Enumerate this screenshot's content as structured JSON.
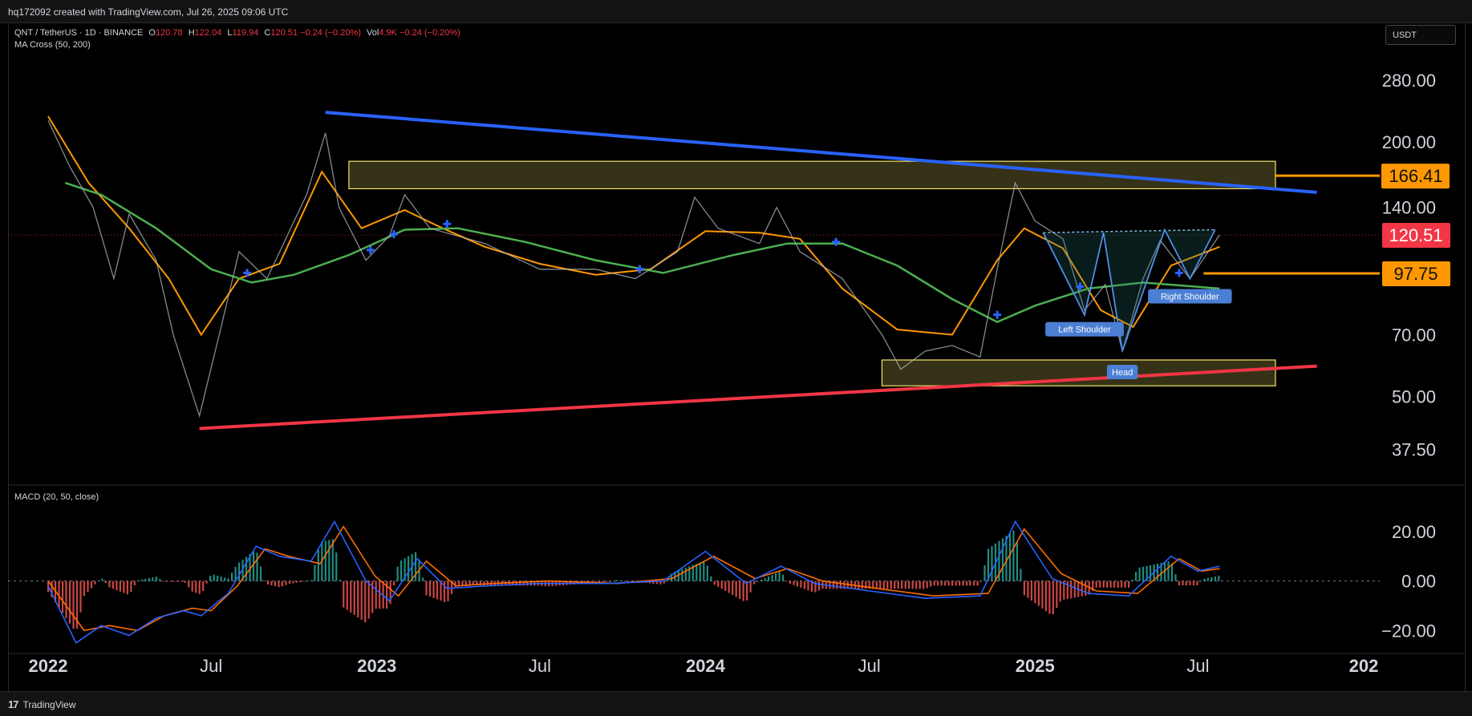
{
  "header": {
    "credit": "hq172092 created with TradingView.com, Jul 26, 2025 09:06 UTC"
  },
  "legend": {
    "symbol": "QNT / TetherUS · 1D · BINANCE",
    "open_label": "O",
    "open": "120.78",
    "high_label": "H",
    "high": "122.04",
    "low_label": "L",
    "low": "119.94",
    "close_label": "C",
    "close": "120.51",
    "change": "−0.24 (−0.20%)",
    "vol_label": "Vol",
    "vol": "4.9K",
    "vol_change": "−0.24 (−0.20%)",
    "indicator": "MA Cross (50, 200)"
  },
  "currency_button": "USDT",
  "macd_legend": "MACD (20, 50, close)",
  "footer": {
    "brand": "TradingView"
  },
  "colors": {
    "background": "#000000",
    "trend_blue": "#2962ff",
    "trend_red": "#f23645",
    "ma_fast": "#ff9800",
    "ma_slow": "#4caf50",
    "zone": "#f5e56b",
    "price_badge": "#f23645",
    "level_badge": "#ff9800",
    "macd_line": "#2962ff",
    "signal_line": "#ff6d00",
    "hist_up": "#26a69a",
    "hist_down": "#ef5350"
  },
  "price_badges": [
    {
      "label": "166.41",
      "color": "#ff9800"
    },
    {
      "label": "120.51",
      "color": "#f23645"
    },
    {
      "label": "97.75",
      "color": "#ff9800"
    }
  ],
  "pattern_labels": [
    "Left Shoulder",
    "Head",
    "Right Shoulder"
  ],
  "chart_data": [
    {
      "type": "line",
      "title": "QNT / TetherUS · 1D · BINANCE",
      "log_scale": true,
      "y_ticks": [
        "280.00",
        "200.00",
        "140.00",
        "70.00",
        "50.00",
        "37.50"
      ],
      "x_ticks": [
        "2022",
        "Jul",
        "2023",
        "Jul",
        "2024",
        "Jul",
        "2025",
        "Jul",
        "202"
      ],
      "ylim": [
        31,
        380
      ],
      "series": [
        {
          "name": "MA 50",
          "values": [
            [
              "2022-01-01",
              230
            ],
            [
              "2022-02-15",
              160
            ],
            [
              "2022-04-01",
              125
            ],
            [
              "2022-05-15",
              95
            ],
            [
              "2022-06-20",
              70
            ],
            [
              "2022-08-01",
              95
            ],
            [
              "2022-09-15",
              103
            ],
            [
              "2022-11-01",
              170
            ],
            [
              "2022-12-15",
              125
            ],
            [
              "2023-02-01",
              138
            ],
            [
              "2023-03-15",
              125
            ],
            [
              "2023-05-01",
              113
            ],
            [
              "2023-07-01",
              103
            ],
            [
              "2023-09-01",
              97
            ],
            [
              "2023-11-01",
              100
            ],
            [
              "2024-01-01",
              123
            ],
            [
              "2024-03-01",
              122
            ],
            [
              "2024-04-15",
              118
            ],
            [
              "2024-06-01",
              90
            ],
            [
              "2024-08-01",
              72
            ],
            [
              "2024-10-01",
              70
            ],
            [
              "2024-11-20",
              105
            ],
            [
              "2024-12-20",
              125
            ],
            [
              "2025-02-01",
              112
            ],
            [
              "2025-03-15",
              80
            ],
            [
              "2025-04-20",
              73
            ],
            [
              "2025-06-01",
              102
            ],
            [
              "2025-07-25",
              113
            ]
          ]
        },
        {
          "name": "MA 200",
          "values": [
            [
              "2022-01-20",
              160
            ],
            [
              "2022-03-01",
              150
            ],
            [
              "2022-05-01",
              125
            ],
            [
              "2022-07-01",
              100
            ],
            [
              "2022-08-15",
              93
            ],
            [
              "2022-10-01",
              97
            ],
            [
              "2022-12-01",
              108
            ],
            [
              "2023-02-01",
              124
            ],
            [
              "2023-04-01",
              125
            ],
            [
              "2023-06-15",
              116
            ],
            [
              "2023-09-01",
              105
            ],
            [
              "2023-11-15",
              98
            ],
            [
              "2024-02-01",
              108
            ],
            [
              "2024-04-01",
              115
            ],
            [
              "2024-06-01",
              115
            ],
            [
              "2024-08-01",
              102
            ],
            [
              "2024-10-01",
              85
            ],
            [
              "2024-11-20",
              75
            ],
            [
              "2025-01-01",
              82
            ],
            [
              "2025-03-01",
              90
            ],
            [
              "2025-05-01",
              93
            ],
            [
              "2025-07-25",
              90
            ]
          ]
        },
        {
          "name": "QNTUSDT close",
          "values": [
            [
              "2022-01-01",
              225
            ],
            [
              "2022-01-25",
              175
            ],
            [
              "2022-02-20",
              140
            ],
            [
              "2022-03-15",
              95
            ],
            [
              "2022-04-01",
              135
            ],
            [
              "2022-05-01",
              105
            ],
            [
              "2022-05-20",
              70
            ],
            [
              "2022-06-18",
              45
            ],
            [
              "2022-07-10",
              70
            ],
            [
              "2022-08-01",
              110
            ],
            [
              "2022-09-01",
              95
            ],
            [
              "2022-10-15",
              150
            ],
            [
              "2022-11-05",
              210
            ],
            [
              "2022-11-20",
              140
            ],
            [
              "2022-12-20",
              105
            ],
            [
              "2023-01-15",
              120
            ],
            [
              "2023-02-01",
              150
            ],
            [
              "2023-03-01",
              125
            ],
            [
              "2023-05-01",
              115
            ],
            [
              "2023-07-01",
              100
            ],
            [
              "2023-09-01",
              100
            ],
            [
              "2023-10-15",
              95
            ],
            [
              "2023-12-01",
              110
            ],
            [
              "2023-12-20",
              148
            ],
            [
              "2024-01-15",
              125
            ],
            [
              "2024-03-01",
              115
            ],
            [
              "2024-03-20",
              140
            ],
            [
              "2024-04-15",
              110
            ],
            [
              "2024-06-01",
              95
            ],
            [
              "2024-07-15",
              70
            ],
            [
              "2024-08-05",
              58
            ],
            [
              "2024-09-01",
              64
            ],
            [
              "2024-10-01",
              66
            ],
            [
              "2024-11-01",
              62
            ],
            [
              "2024-11-20",
              100
            ],
            [
              "2024-12-10",
              160
            ],
            [
              "2025-01-01",
              130
            ],
            [
              "2025-02-01",
              118
            ],
            [
              "2025-02-25",
              80
            ],
            [
              "2025-03-20",
              92
            ],
            [
              "2025-04-08",
              64
            ],
            [
              "2025-05-01",
              95
            ],
            [
              "2025-05-20",
              117
            ],
            [
              "2025-06-22",
              95
            ],
            [
              "2025-07-25",
              120.51
            ]
          ]
        }
      ],
      "lines": [
        {
          "name": "descending resistance",
          "start": [
            "2022-11-05",
            235
          ],
          "end": [
            "2025-11-10",
            152
          ]
        },
        {
          "name": "ascending support",
          "start": [
            "2022-06-18",
            42
          ],
          "end": [
            "2025-11-10",
            59
          ]
        }
      ],
      "zones": [
        {
          "name": "resistance zone",
          "from": "2022-12-01",
          "to": "2025-09-25",
          "low": 155,
          "high": 180
        },
        {
          "name": "support zone",
          "from": "2024-07-15",
          "to": "2025-09-25",
          "low": 53,
          "high": 61
        }
      ],
      "cross_markers": [
        [
          "2022-08-10",
          98
        ],
        [
          "2022-12-25",
          111
        ],
        [
          "2023-01-20",
          121
        ],
        [
          "2023-03-20",
          128
        ],
        [
          "2023-10-20",
          100
        ],
        [
          "2024-05-25",
          116
        ],
        [
          "2024-11-20",
          78
        ],
        [
          "2025-02-20",
          91
        ],
        [
          "2025-06-10",
          98
        ]
      ],
      "levels": [
        {
          "value": 166.41
        },
        {
          "value": 120.51
        },
        {
          "value": 97.75
        }
      ],
      "head_and_shoulders": {
        "left_shoulder": [
          "2025-02-25",
          78
        ],
        "head": [
          "2025-04-08",
          64
        ],
        "right_shoulder": [
          "2025-06-22",
          95
        ],
        "neckline": [
          [
            "2025-01-10",
            122
          ],
          [
            "2025-07-20",
            124
          ]
        ]
      }
    },
    {
      "type": "line",
      "title": "MACD (20, 50, close)",
      "y_ticks": [
        "20.00",
        "0.00",
        "−20.00"
      ],
      "ylim": [
        -27,
        30
      ],
      "series": [
        {
          "name": "MACD",
          "values": [
            [
              "2022-01-01",
              -2
            ],
            [
              "2022-02-01",
              -25
            ],
            [
              "2022-03-01",
              -18
            ],
            [
              "2022-04-01",
              -22
            ],
            [
              "2022-05-01",
              -15
            ],
            [
              "2022-06-01",
              -12
            ],
            [
              "2022-06-20",
              -14
            ],
            [
              "2022-07-20",
              -5
            ],
            [
              "2022-08-20",
              14
            ],
            [
              "2022-09-15",
              10
            ],
            [
              "2022-10-20",
              8
            ],
            [
              "2022-11-15",
              24
            ],
            [
              "2022-12-20",
              0
            ],
            [
              "2023-01-15",
              -8
            ],
            [
              "2023-02-15",
              9
            ],
            [
              "2023-03-20",
              -3
            ],
            [
              "2023-05-01",
              -2
            ],
            [
              "2023-07-01",
              -1
            ],
            [
              "2023-09-15",
              -1
            ],
            [
              "2023-11-15",
              0
            ],
            [
              "2024-01-01",
              12
            ],
            [
              "2024-02-15",
              -1
            ],
            [
              "2024-03-25",
              6
            ],
            [
              "2024-05-01",
              -1
            ],
            [
              "2024-07-01",
              -4
            ],
            [
              "2024-09-01",
              -7
            ],
            [
              "2024-11-01",
              -6
            ],
            [
              "2024-12-10",
              24
            ],
            [
              "2025-01-20",
              1
            ],
            [
              "2025-03-01",
              -5
            ],
            [
              "2025-04-15",
              -6
            ],
            [
              "2025-06-01",
              10
            ],
            [
              "2025-07-01",
              4
            ],
            [
              "2025-07-25",
              6
            ]
          ]
        },
        {
          "name": "Signal",
          "values": [
            [
              "2022-01-01",
              0
            ],
            [
              "2022-02-10",
              -20
            ],
            [
              "2022-03-10",
              -18
            ],
            [
              "2022-04-10",
              -20
            ],
            [
              "2022-05-10",
              -14
            ],
            [
              "2022-06-10",
              -11
            ],
            [
              "2022-07-01",
              -12
            ],
            [
              "2022-07-30",
              -2
            ],
            [
              "2022-08-30",
              13
            ],
            [
              "2022-09-25",
              10
            ],
            [
              "2022-10-30",
              7
            ],
            [
              "2022-11-25",
              22
            ],
            [
              "2022-12-30",
              2
            ],
            [
              "2023-01-25",
              -6
            ],
            [
              "2023-02-25",
              8
            ],
            [
              "2023-03-30",
              -2
            ],
            [
              "2023-05-10",
              -1
            ],
            [
              "2023-07-10",
              0
            ],
            [
              "2023-09-25",
              -1
            ],
            [
              "2023-11-25",
              1
            ],
            [
              "2024-01-10",
              10
            ],
            [
              "2024-02-25",
              1
            ],
            [
              "2024-04-01",
              5
            ],
            [
              "2024-05-10",
              0
            ],
            [
              "2024-07-10",
              -3
            ],
            [
              "2024-09-10",
              -6
            ],
            [
              "2024-11-10",
              -5
            ],
            [
              "2024-12-20",
              21
            ],
            [
              "2025-01-30",
              3
            ],
            [
              "2025-03-10",
              -4
            ],
            [
              "2025-04-25",
              -5
            ],
            [
              "2025-06-10",
              9
            ],
            [
              "2025-07-05",
              4
            ],
            [
              "2025-07-25",
              5
            ]
          ]
        }
      ]
    }
  ]
}
